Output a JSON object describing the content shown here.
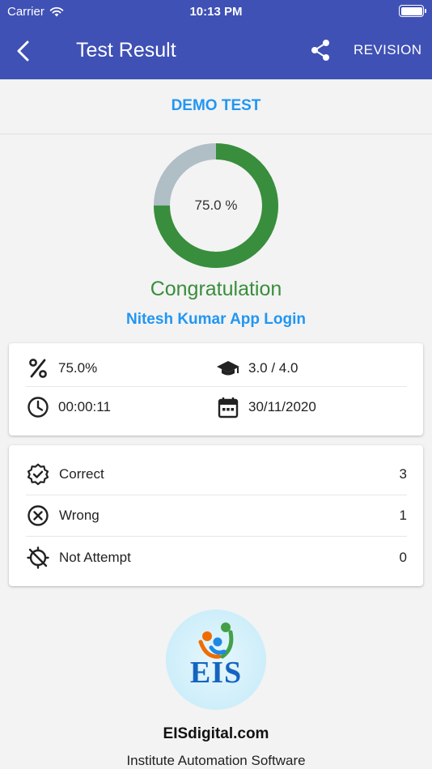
{
  "status_bar": {
    "carrier": "Carrier",
    "time": "10:13 PM"
  },
  "app_bar": {
    "title": "Test Result",
    "revision_label": "REVISION"
  },
  "test": {
    "name": "DEMO TEST"
  },
  "score": {
    "percent_label": "75.0 %",
    "percent_value": 75.0,
    "ring_color": "#388e3c",
    "ring_track_color": "#b0bec5"
  },
  "congrats": "Congratulation",
  "user": {
    "name": "Nitesh Kumar App Login"
  },
  "summary": {
    "percentage": "75.0%",
    "marks": "3.0 / 4.0",
    "duration": "00:00:11",
    "date": "30/11/2020"
  },
  "results": [
    {
      "label": "Correct",
      "count": "3",
      "icon": "badge-check-icon"
    },
    {
      "label": "Wrong",
      "count": "1",
      "icon": "x-circle-icon"
    },
    {
      "label": "Not Attempt",
      "count": "0",
      "icon": "crosshair-off-icon"
    }
  ],
  "footer": {
    "logo_text": "EIS",
    "site": "EISdigital.com",
    "tagline": "Institute Automation Software"
  },
  "colors": {
    "primary": "#3f51b5",
    "accent": "#2196f3",
    "success": "#388e3c"
  }
}
